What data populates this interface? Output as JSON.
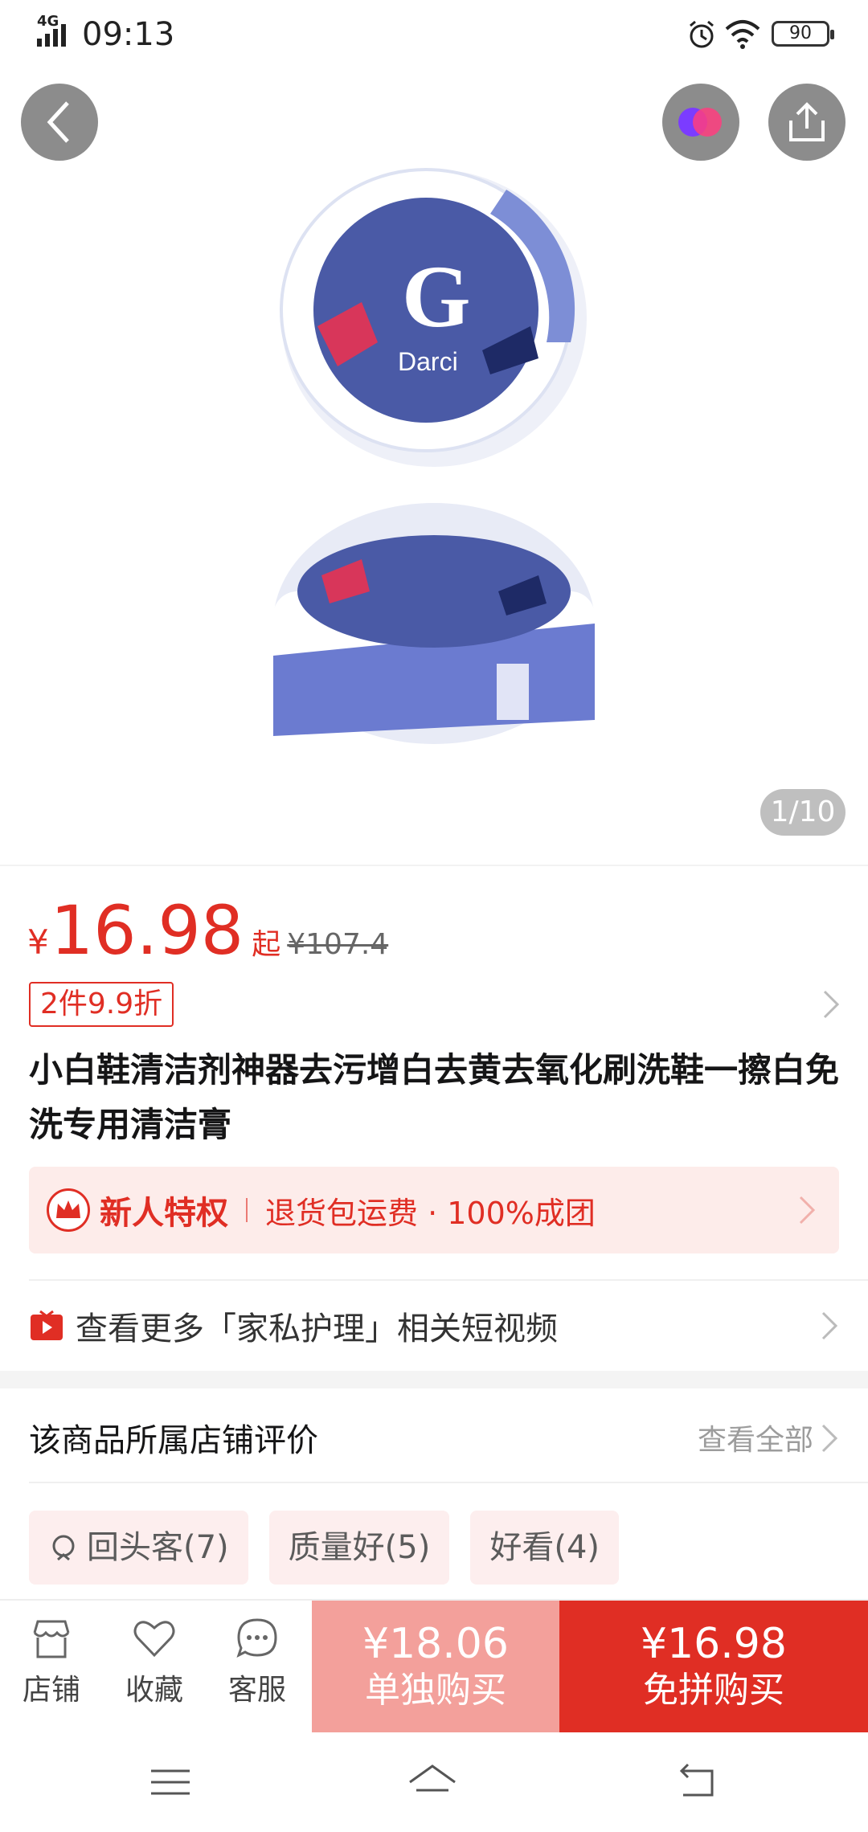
{
  "status_bar": {
    "network": "4G",
    "time": "09:13",
    "battery": "90",
    "icons": [
      "signal-icon",
      "alarm-icon",
      "wifi-icon",
      "battery-icon"
    ]
  },
  "hero": {
    "image_counter": "1/10",
    "icons": [
      "back-arrow-icon",
      "brand-logo-icon",
      "share-icon"
    ]
  },
  "product": {
    "currency": "¥",
    "price": "16.98",
    "price_suffix": "起",
    "original_price": "¥107.4",
    "discount_tag": "2件9.9折",
    "title": "小白鞋清洁剂神器去污增白去黄去氧化刷洗鞋一擦白免洗专用清洁膏"
  },
  "perks": {
    "label": "新人特权",
    "text": "退货包运费 · 100%成团"
  },
  "video_row": {
    "text": "查看更多「家私护理」相关短视频"
  },
  "reviews": {
    "title": "该商品所属店铺评价",
    "view_all": "查看全部",
    "tags": [
      "回头客(7)",
      "质量好(5)",
      "好看(4)"
    ]
  },
  "action_bar": {
    "store_label": "店铺",
    "favorite_label": "收藏",
    "service_label": "客服",
    "solo_price": "¥18.06",
    "solo_label": "单独购买",
    "group_price": "¥16.98",
    "group_label": "免拼购买"
  },
  "colors": {
    "accent": "#e02e24",
    "accent_light": "#f3a09b",
    "perk_bg": "#fdecea"
  }
}
